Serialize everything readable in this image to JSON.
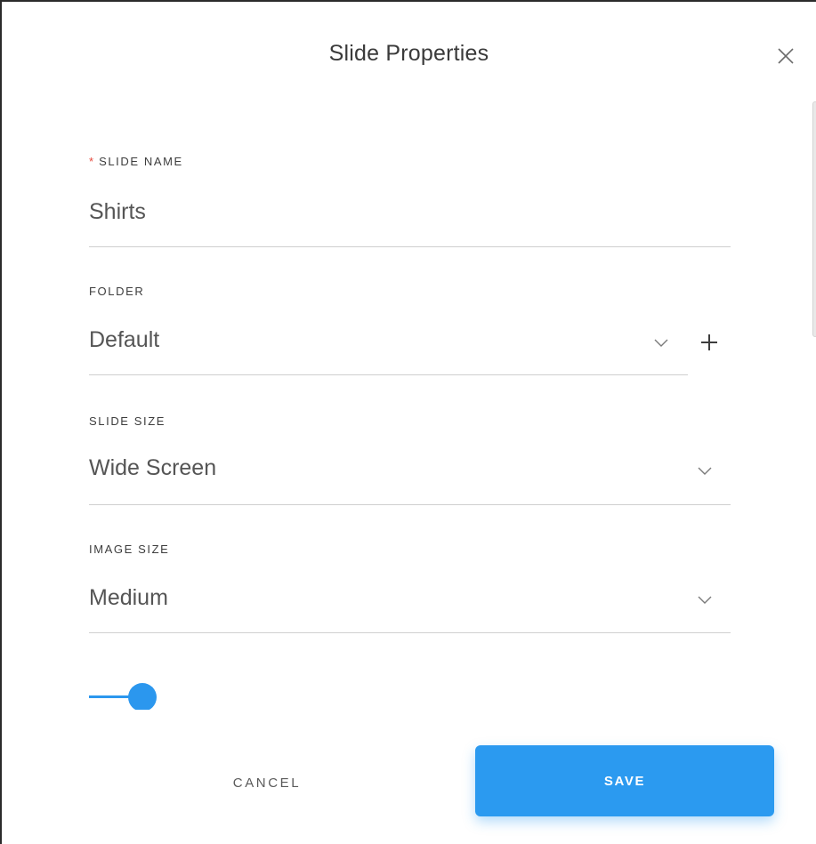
{
  "dialog": {
    "title": "Slide Properties",
    "close_icon": "close-icon"
  },
  "fields": {
    "slide_name": {
      "required_marker": "*",
      "label": "SLIDE NAME",
      "value": "Shirts"
    },
    "folder": {
      "label": "FOLDER",
      "value": "Default",
      "dropdown_icon": "chevron-down-icon",
      "add_icon": "plus-icon"
    },
    "slide_size": {
      "label": "SLIDE SIZE",
      "value": "Wide Screen",
      "dropdown_icon": "chevron-down-icon"
    },
    "image_size": {
      "label": "IMAGE SIZE",
      "value": "Medium",
      "dropdown_icon": "chevron-down-icon"
    }
  },
  "toggle": {
    "on": true
  },
  "actions": {
    "cancel_label": "CANCEL",
    "save_label": "SAVE"
  },
  "colors": {
    "accent": "#2b9af0",
    "required": "#e5483c",
    "title_text": "#3a3a3a",
    "divider": "#cfcfcf"
  }
}
